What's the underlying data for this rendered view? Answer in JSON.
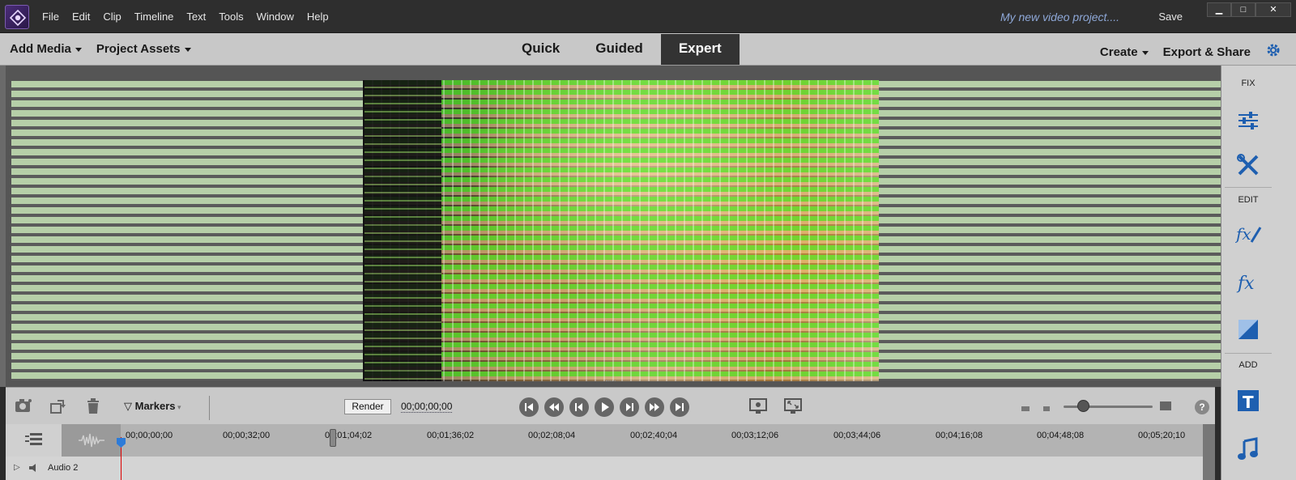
{
  "menu": [
    "File",
    "Edit",
    "Clip",
    "Timeline",
    "Text",
    "Tools",
    "Window",
    "Help"
  ],
  "project_title": "My new video project....",
  "save_label": "Save",
  "window_controls": {
    "minimize": "▁",
    "maximize": "□",
    "close": "✕"
  },
  "modebar": {
    "add_media": "Add Media",
    "project_assets": "Project Assets",
    "tabs": [
      "Quick",
      "Guided",
      "Expert"
    ],
    "active_tab": "Expert",
    "create": "Create",
    "export_share": "Export & Share"
  },
  "right_panel": {
    "fix_label": "FIX",
    "edit_label": "EDIT",
    "add_label": "ADD",
    "icons": [
      "adjustments-icon",
      "tools-icon",
      "fx-edit-icon",
      "fx-icon",
      "transitions-icon",
      "title-icon",
      "music-icon"
    ]
  },
  "controls": {
    "markers_label": "Markers",
    "render_label": "Render",
    "timecode": "00;00;00;00",
    "help": "?"
  },
  "timeline": {
    "ruler_labels": [
      "00;00;00;00",
      "00;00;32;00",
      "00;01;04;02",
      "00;01;36;02",
      "00;02;08;04",
      "00;02;40;04",
      "00;03;12;06",
      "00;03;44;06",
      "00;04;16;08",
      "00;04;48;08",
      "00;05;20;10"
    ],
    "track_name": "Audio 2"
  },
  "colors": {
    "accent": "#2d7bd8",
    "active_tab_bg": "#333333",
    "project_title": "#8ea8d8",
    "playhead": "#dd0000"
  }
}
